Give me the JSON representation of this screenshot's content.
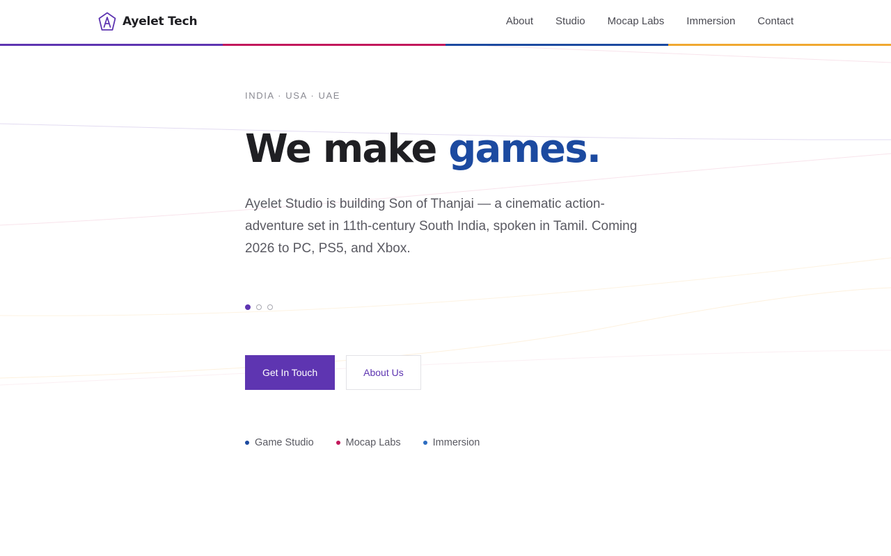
{
  "brand": {
    "name": "Ayelet Tech",
    "logo_letter": "A",
    "accent_color": "#5e35b1"
  },
  "nav": {
    "items": [
      {
        "label": "About"
      },
      {
        "label": "Studio"
      },
      {
        "label": "Mocap Labs"
      },
      {
        "label": "Immersion"
      },
      {
        "label": "Contact"
      }
    ]
  },
  "stripe_colors": [
    "#5e35b1",
    "#c2185b",
    "#1c4aa0",
    "#f0a830"
  ],
  "hero": {
    "regions": "INDIA · USA · UAE",
    "headline_plain": "We make ",
    "headline_accent": "games.",
    "headline_accent_color": "#1c4aa0",
    "lead": "Ayelet Studio is building Son of Thanjai — a cinematic action-adventure set in 11th-century South India, spoken in Tamil. Coming 2026 to PC, PS5, and Xbox.",
    "carousel": {
      "total": 3,
      "active": 0
    },
    "primary_button": "Get In Touch",
    "secondary_button": "About Us"
  },
  "divisions": [
    {
      "label": "Game Studio",
      "color": "#1c4aa0"
    },
    {
      "label": "Mocap Labs",
      "color": "#c2185b"
    },
    {
      "label": "Immersion",
      "color": "#2d6cc0"
    }
  ]
}
